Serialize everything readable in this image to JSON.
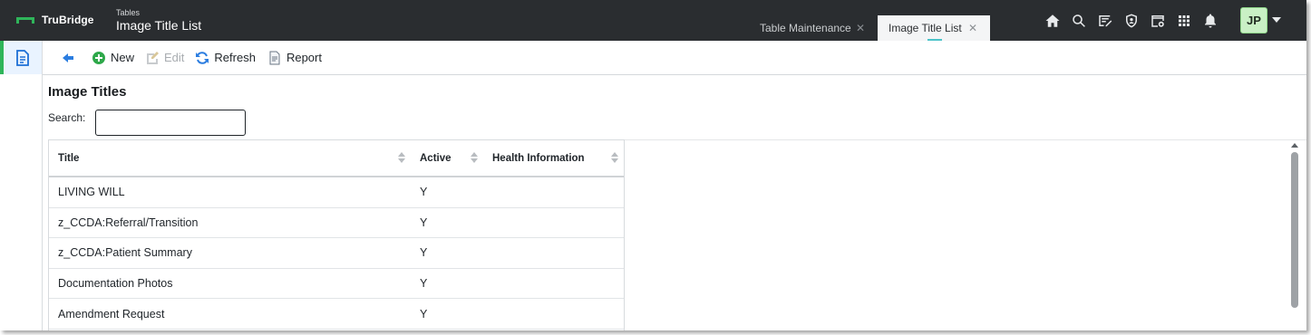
{
  "app": {
    "brand": "TruBridge",
    "breadcrumb_small": "Tables",
    "breadcrumb_title": "Image Title List",
    "accent_color": "#2fb55a"
  },
  "tabs": [
    {
      "label": "Table Maintenance",
      "active": false
    },
    {
      "label": "Image Title List",
      "active": true
    }
  ],
  "top_icons": [
    "home-icon",
    "search-icon",
    "edit-board-icon",
    "shield-user-icon",
    "calendar-settings-icon",
    "apps-grid-icon",
    "bell-icon"
  ],
  "user": {
    "initials": "JP"
  },
  "toolbar": {
    "back_icon": "back-arrow-icon",
    "new_label": "New",
    "edit_label": "Edit",
    "refresh_label": "Refresh",
    "report_label": "Report"
  },
  "page": {
    "heading": "Image Titles",
    "search_label": "Search:",
    "search_value": ""
  },
  "grid": {
    "columns": [
      "Title",
      "Active",
      "Health Information"
    ],
    "rows": [
      {
        "title": "LIVING WILL",
        "active": "Y",
        "health": ""
      },
      {
        "title": "z_CCDA:Referral/Transition",
        "active": "Y",
        "health": ""
      },
      {
        "title": "z_CCDA:Patient Summary",
        "active": "Y",
        "health": ""
      },
      {
        "title": "Documentation Photos",
        "active": "Y",
        "health": ""
      },
      {
        "title": "Amendment Request",
        "active": "Y",
        "health": ""
      }
    ]
  }
}
